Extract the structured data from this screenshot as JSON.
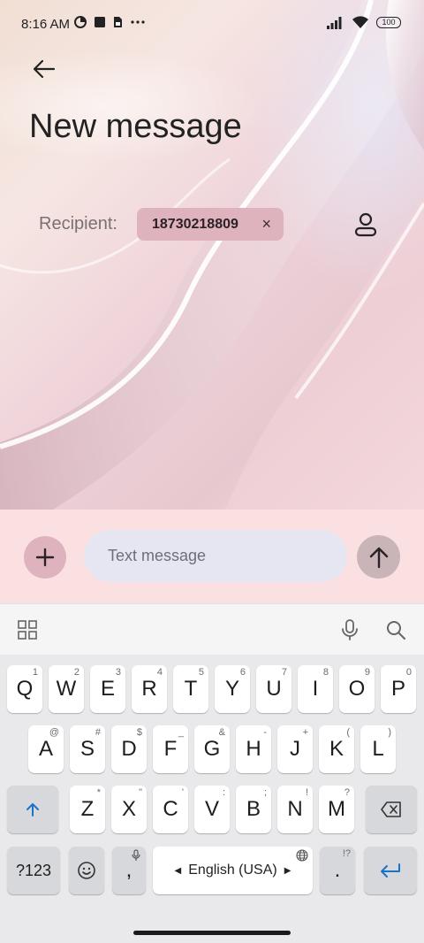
{
  "status_bar": {
    "time": "8:16 AM",
    "battery": "100",
    "left_icons": [
      "data-saver-icon",
      "square-notification-icon",
      "sim-card-icon",
      "more-dots-icon"
    ],
    "right_icons": [
      "signal-icon",
      "wifi-icon",
      "battery-icon"
    ]
  },
  "header": {
    "title": "New message"
  },
  "recipient": {
    "label": "Recipient:",
    "chip_value": "18730218809",
    "chip_remove": "×"
  },
  "compose": {
    "placeholder": "Text message"
  },
  "keyboard": {
    "row1": [
      {
        "key": "Q",
        "hint": "1"
      },
      {
        "key": "W",
        "hint": "2"
      },
      {
        "key": "E",
        "hint": "3"
      },
      {
        "key": "R",
        "hint": "4"
      },
      {
        "key": "T",
        "hint": "5"
      },
      {
        "key": "Y",
        "hint": "6"
      },
      {
        "key": "U",
        "hint": "7"
      },
      {
        "key": "I",
        "hint": "8"
      },
      {
        "key": "O",
        "hint": "9"
      },
      {
        "key": "P",
        "hint": "0"
      }
    ],
    "row2": [
      {
        "key": "A",
        "hint": "@"
      },
      {
        "key": "S",
        "hint": "#"
      },
      {
        "key": "D",
        "hint": "$"
      },
      {
        "key": "F",
        "hint": "_"
      },
      {
        "key": "G",
        "hint": "&"
      },
      {
        "key": "H",
        "hint": "-"
      },
      {
        "key": "J",
        "hint": "+"
      },
      {
        "key": "K",
        "hint": "("
      },
      {
        "key": "L",
        "hint": ")"
      }
    ],
    "row3": [
      {
        "key": "Z",
        "hint": "*"
      },
      {
        "key": "X",
        "hint": "\""
      },
      {
        "key": "C",
        "hint": "'"
      },
      {
        "key": "V",
        "hint": ":"
      },
      {
        "key": "B",
        "hint": ";"
      },
      {
        "key": "N",
        "hint": "!"
      },
      {
        "key": "M",
        "hint": "?"
      }
    ],
    "symbols_key": "?123",
    "comma_key": ",",
    "space_label": "English (USA)",
    "period_key": ".",
    "period_hint": "!?"
  },
  "colors": {
    "accent": "#deb3bd",
    "compose_bg": "#fbe0e2",
    "input_bg": "#e6e6f2",
    "enter_key": "#1a73c8"
  }
}
